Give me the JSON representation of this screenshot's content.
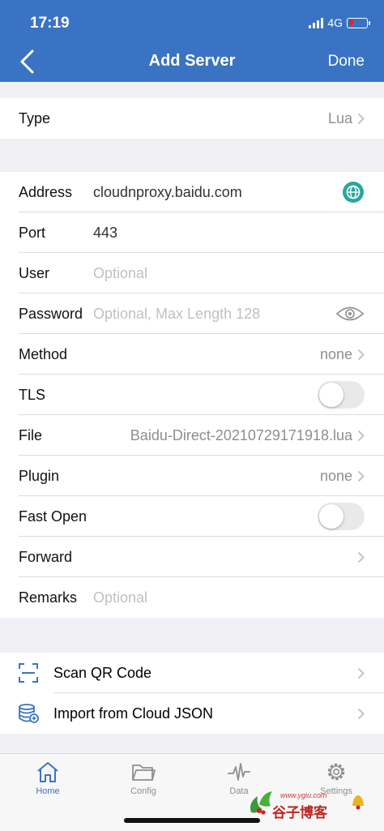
{
  "status_bar": {
    "time": "17:19",
    "network": "4G"
  },
  "nav": {
    "title": "Add Server",
    "done_label": "Done"
  },
  "type_row": {
    "label": "Type",
    "value": "Lua"
  },
  "form": {
    "address": {
      "label": "Address",
      "value": "cloudnproxy.baidu.com"
    },
    "port": {
      "label": "Port",
      "value": "443"
    },
    "user": {
      "label": "User",
      "placeholder": "Optional"
    },
    "password": {
      "label": "Password",
      "placeholder": "Optional, Max Length 128"
    },
    "method": {
      "label": "Method",
      "value": "none"
    },
    "tls": {
      "label": "TLS",
      "on": false
    },
    "file": {
      "label": "File",
      "value": "Baidu-Direct-20210729171918.lua"
    },
    "plugin": {
      "label": "Plugin",
      "value": "none"
    },
    "fast_open": {
      "label": "Fast Open",
      "on": false
    },
    "forward": {
      "label": "Forward"
    },
    "remarks": {
      "label": "Remarks",
      "placeholder": "Optional"
    }
  },
  "actions": {
    "scan": {
      "label": "Scan QR Code",
      "icon": "scan-qr-icon"
    },
    "import": {
      "label": "Import from Cloud JSON",
      "icon": "cloud-database-icon"
    }
  },
  "tabbar": {
    "home": "Home",
    "config": "Config",
    "data": "Data",
    "settings": "Settings"
  },
  "watermark": {
    "url": "www.ygiu.com",
    "name": "谷子博客"
  },
  "colors": {
    "header": "#3a73c4",
    "accent": "#2aa79b",
    "tab_active": "#3a73c4"
  }
}
